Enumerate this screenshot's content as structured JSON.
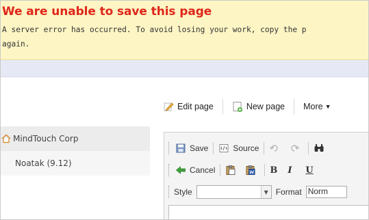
{
  "error": {
    "title": "We are unable to save this page",
    "line1": "A server error has occurred. To avoid losing your work, copy the p",
    "line2": "again."
  },
  "page_toolbar": {
    "edit_label": "Edit page",
    "new_label": "New page",
    "more_label": "More"
  },
  "sidebar": {
    "items": [
      {
        "label": "MindTouch Corp",
        "icon": "home-icon"
      },
      {
        "label": "Noatak (9.12)"
      }
    ]
  },
  "editor": {
    "save_label": "Save",
    "source_label": "Source",
    "cancel_label": "Cancel",
    "bold": "B",
    "italic": "I",
    "underline": "U",
    "style_label": "Style",
    "style_value": "",
    "format_label": "Format",
    "format_value": "Norm"
  },
  "colors": {
    "error_title": "#e0261a",
    "banner_bg": "#fdf5c4",
    "nav_strip": "#e6e9f5"
  }
}
